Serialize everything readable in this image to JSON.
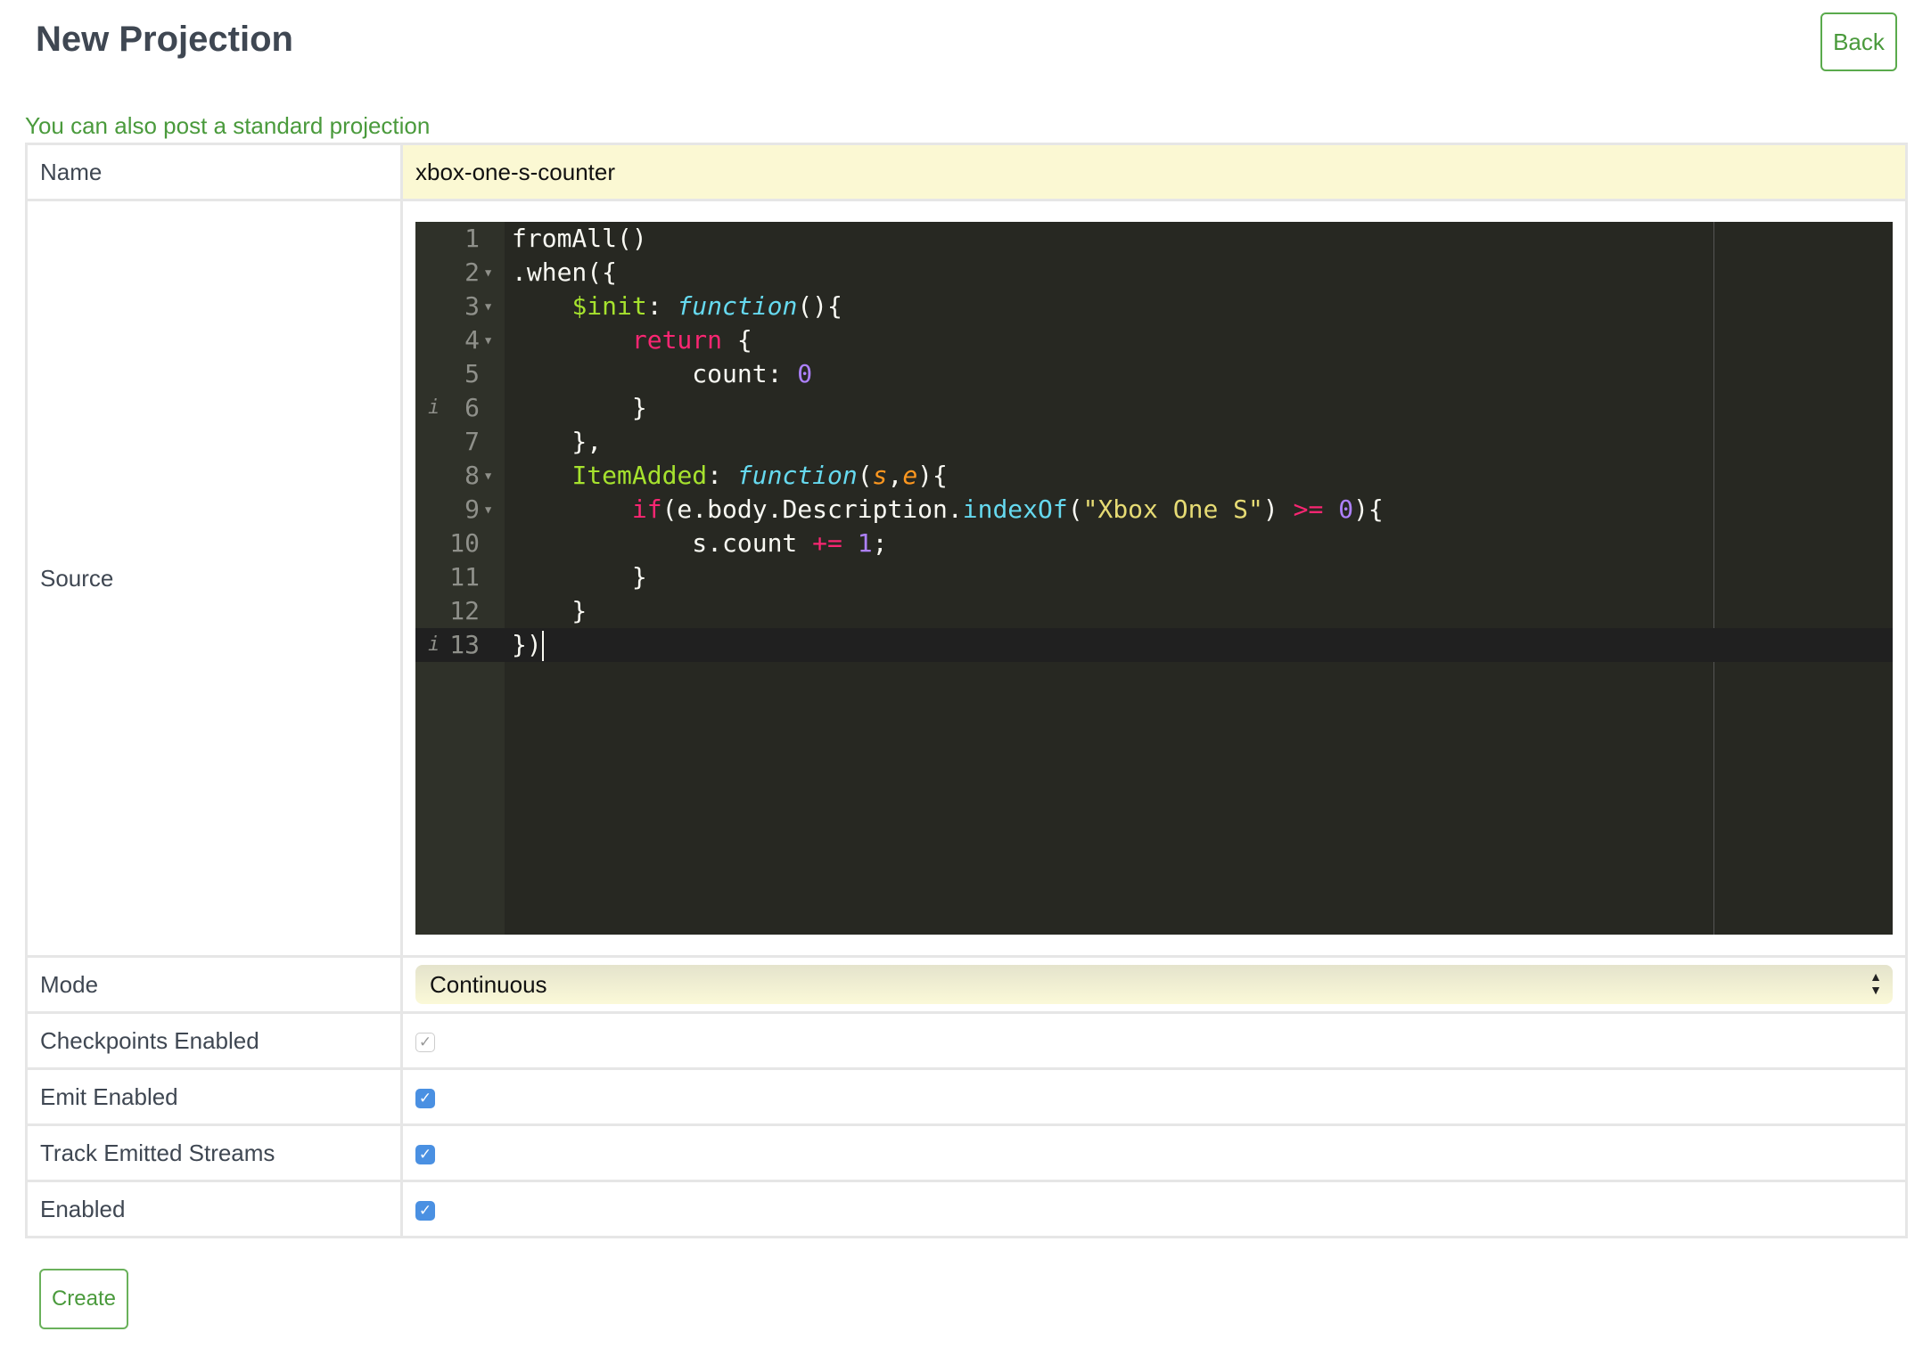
{
  "header": {
    "title": "New Projection",
    "back_label": "Back"
  },
  "standard_link": "You can also post a standard projection",
  "form": {
    "name_label": "Name",
    "name_value": "xbox-one-s-counter",
    "source_label": "Source",
    "mode_label": "Mode",
    "mode_value": "Continuous",
    "checkpoints_label": "Checkpoints Enabled",
    "checkpoints_checked": true,
    "checkpoints_disabled": true,
    "emit_label": "Emit Enabled",
    "emit_checked": true,
    "track_label": "Track Emitted Streams",
    "track_checked": true,
    "enabled_label": "Enabled",
    "enabled_checked": true
  },
  "editor": {
    "colors": {
      "background": "#272822",
      "gutter": "#2f3129"
    },
    "lines": [
      {
        "n": "1",
        "tokens": [
          [
            "plain",
            "fromAll()"
          ]
        ]
      },
      {
        "n": "2",
        "fold": true,
        "tokens": [
          [
            "plain",
            ".when({"
          ]
        ]
      },
      {
        "n": "3",
        "fold": true,
        "tokens": [
          [
            "plain",
            "    "
          ],
          [
            "key",
            "$init"
          ],
          [
            "plain",
            ": "
          ],
          [
            "fn",
            "function"
          ],
          [
            "plain",
            "(){"
          ]
        ]
      },
      {
        "n": "4",
        "fold": true,
        "tokens": [
          [
            "plain",
            "        "
          ],
          [
            "kw",
            "return"
          ],
          [
            "plain",
            " {"
          ]
        ]
      },
      {
        "n": "5",
        "tokens": [
          [
            "plain",
            "            count: "
          ],
          [
            "num",
            "0"
          ]
        ]
      },
      {
        "n": "6",
        "info": true,
        "tokens": [
          [
            "plain",
            "        }"
          ]
        ]
      },
      {
        "n": "7",
        "tokens": [
          [
            "plain",
            "    },"
          ]
        ]
      },
      {
        "n": "8",
        "fold": true,
        "tokens": [
          [
            "plain",
            "    "
          ],
          [
            "key",
            "ItemAdded"
          ],
          [
            "plain",
            ": "
          ],
          [
            "fn",
            "function"
          ],
          [
            "plain",
            "("
          ],
          [
            "param",
            "s"
          ],
          [
            "plain",
            ","
          ],
          [
            "param",
            "e"
          ],
          [
            "plain",
            "){"
          ]
        ]
      },
      {
        "n": "9",
        "fold": true,
        "tokens": [
          [
            "plain",
            "        "
          ],
          [
            "kw",
            "if"
          ],
          [
            "plain",
            "(e.body.Description."
          ],
          [
            "call",
            "indexOf"
          ],
          [
            "plain",
            "("
          ],
          [
            "str",
            "\"Xbox One S\""
          ],
          [
            "plain",
            ") "
          ],
          [
            "kw",
            ">="
          ],
          [
            "plain",
            " "
          ],
          [
            "num",
            "0"
          ],
          [
            "plain",
            "){"
          ]
        ]
      },
      {
        "n": "10",
        "tokens": [
          [
            "plain",
            "            s.count "
          ],
          [
            "kw",
            "+="
          ],
          [
            "plain",
            " "
          ],
          [
            "num",
            "1"
          ],
          [
            "plain",
            ";"
          ]
        ]
      },
      {
        "n": "11",
        "tokens": [
          [
            "plain",
            "        }"
          ]
        ]
      },
      {
        "n": "12",
        "tokens": [
          [
            "plain",
            "    }"
          ]
        ]
      },
      {
        "n": "13",
        "info": true,
        "active": true,
        "tokens": [
          [
            "plain",
            "})"
          ]
        ]
      }
    ]
  },
  "create_label": "Create"
}
